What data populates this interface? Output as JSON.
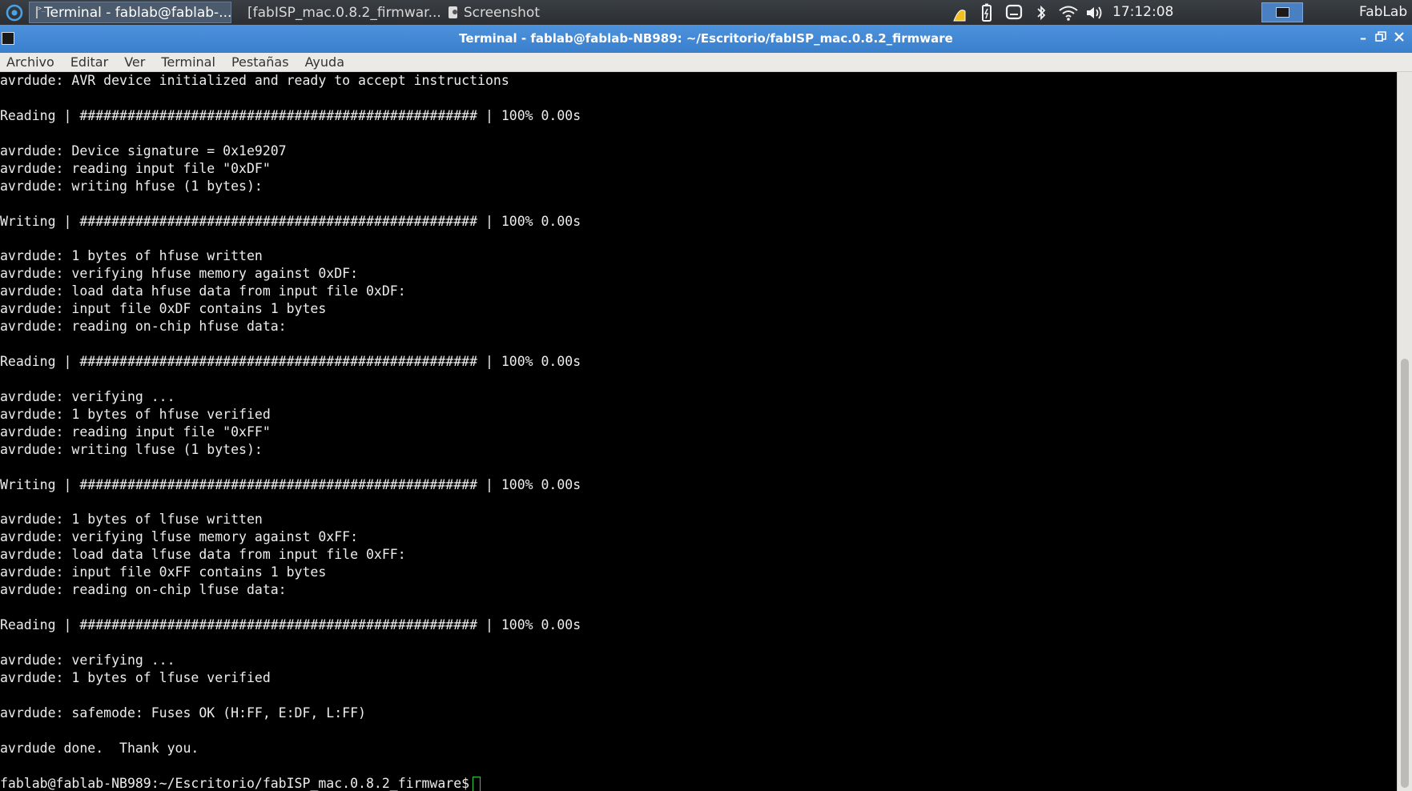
{
  "panel": {
    "tasks": [
      {
        "label": "Terminal - fablab@fablab-...",
        "icon": "terminal-icon",
        "active": true
      },
      {
        "label": "[fabISP_mac.0.8.2_firmwar...",
        "icon": "folder-icon",
        "active": false
      },
      {
        "label": "Screenshot",
        "icon": "screenshot-icon",
        "active": false
      }
    ],
    "clock": "17:12:08",
    "user": "FabLab"
  },
  "window": {
    "title": "Terminal - fablab@fablab-NB989: ~/Escritorio/fabISP_mac.0.8.2_firmware"
  },
  "menubar": [
    "Archivo",
    "Editar",
    "Ver",
    "Terminal",
    "Pestañas",
    "Ayuda"
  ],
  "terminal": {
    "lines": [
      "avrdude: AVR device initialized and ready to accept instructions",
      "",
      "Reading | ################################################## | 100% 0.00s",
      "",
      "avrdude: Device signature = 0x1e9207",
      "avrdude: reading input file \"0xDF\"",
      "avrdude: writing hfuse (1 bytes):",
      "",
      "Writing | ################################################## | 100% 0.00s",
      "",
      "avrdude: 1 bytes of hfuse written",
      "avrdude: verifying hfuse memory against 0xDF:",
      "avrdude: load data hfuse data from input file 0xDF:",
      "avrdude: input file 0xDF contains 1 bytes",
      "avrdude: reading on-chip hfuse data:",
      "",
      "Reading | ################################################## | 100% 0.00s",
      "",
      "avrdude: verifying ...",
      "avrdude: 1 bytes of hfuse verified",
      "avrdude: reading input file \"0xFF\"",
      "avrdude: writing lfuse (1 bytes):",
      "",
      "Writing | ################################################## | 100% 0.00s",
      "",
      "avrdude: 1 bytes of lfuse written",
      "avrdude: verifying lfuse memory against 0xFF:",
      "avrdude: load data lfuse data from input file 0xFF:",
      "avrdude: input file 0xFF contains 1 bytes",
      "avrdude: reading on-chip lfuse data:",
      "",
      "Reading | ################################################## | 100% 0.00s",
      "",
      "avrdude: verifying ...",
      "avrdude: 1 bytes of lfuse verified",
      "",
      "avrdude: safemode: Fuses OK (H:FF, E:DF, L:FF)",
      "",
      "avrdude done.  Thank you.",
      ""
    ],
    "prompt": "fablab@fablab-NB989:~/Escritorio/fabISP_mac.0.8.2_firmware$"
  },
  "colors": {
    "titlebar": "#3a7fcc",
    "panel": "#2b2f33",
    "cursor": "#2ecc40"
  }
}
